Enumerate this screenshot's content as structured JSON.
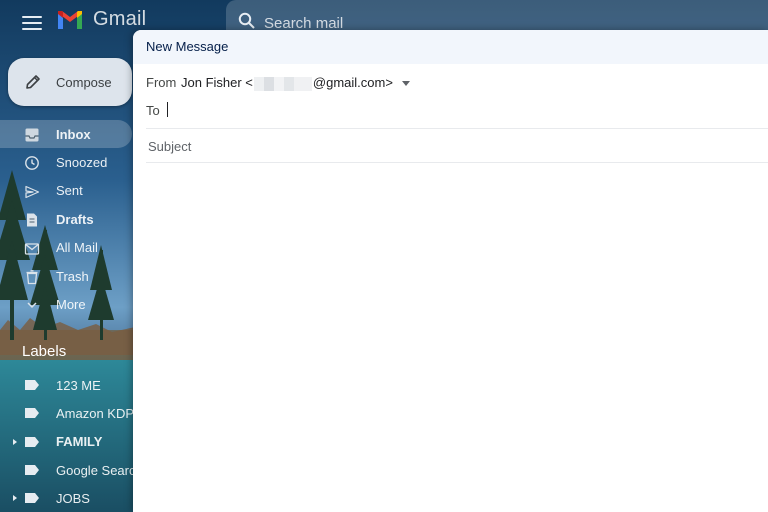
{
  "app": {
    "logo_text": "Gmail"
  },
  "search": {
    "placeholder": "Search mail"
  },
  "compose_button": {
    "label": "Compose"
  },
  "nav": {
    "items": [
      {
        "label": "Inbox",
        "icon": "inbox-icon",
        "active": true,
        "bold": true
      },
      {
        "label": "Snoozed",
        "icon": "clock-icon",
        "active": false,
        "bold": false
      },
      {
        "label": "Sent",
        "icon": "send-icon",
        "active": false,
        "bold": false
      },
      {
        "label": "Drafts",
        "icon": "draft-icon",
        "active": false,
        "bold": true
      },
      {
        "label": "All Mail",
        "icon": "all-mail-icon",
        "active": false,
        "bold": false
      },
      {
        "label": "Trash",
        "icon": "trash-icon",
        "active": false,
        "bold": false
      },
      {
        "label": "More",
        "icon": "chevron-down-icon",
        "active": false,
        "bold": false
      }
    ]
  },
  "labels": {
    "heading": "Labels",
    "items": [
      {
        "label": "123 ME",
        "expandable": false,
        "bold": false
      },
      {
        "label": "Amazon KDP",
        "expandable": false,
        "bold": false
      },
      {
        "label": "FAMILY",
        "expandable": true,
        "bold": true
      },
      {
        "label": "Google Search",
        "expandable": false,
        "bold": false
      },
      {
        "label": "JOBS",
        "expandable": true,
        "bold": false
      }
    ]
  },
  "compose_window": {
    "title": "New Message",
    "from_label": "From",
    "from_name": "Jon Fisher <",
    "from_email_suffix": "@gmail.com>",
    "to_label": "To",
    "to_value": "",
    "subject_placeholder": "Subject",
    "subject_value": ""
  },
  "colors": {
    "gmail_red": "#ea4335",
    "gmail_blue": "#4285f4",
    "gmail_green": "#34a853",
    "gmail_yellow": "#fbbc04",
    "compose_header_bg": "#f2f6fc",
    "compose_title": "#041e49"
  }
}
